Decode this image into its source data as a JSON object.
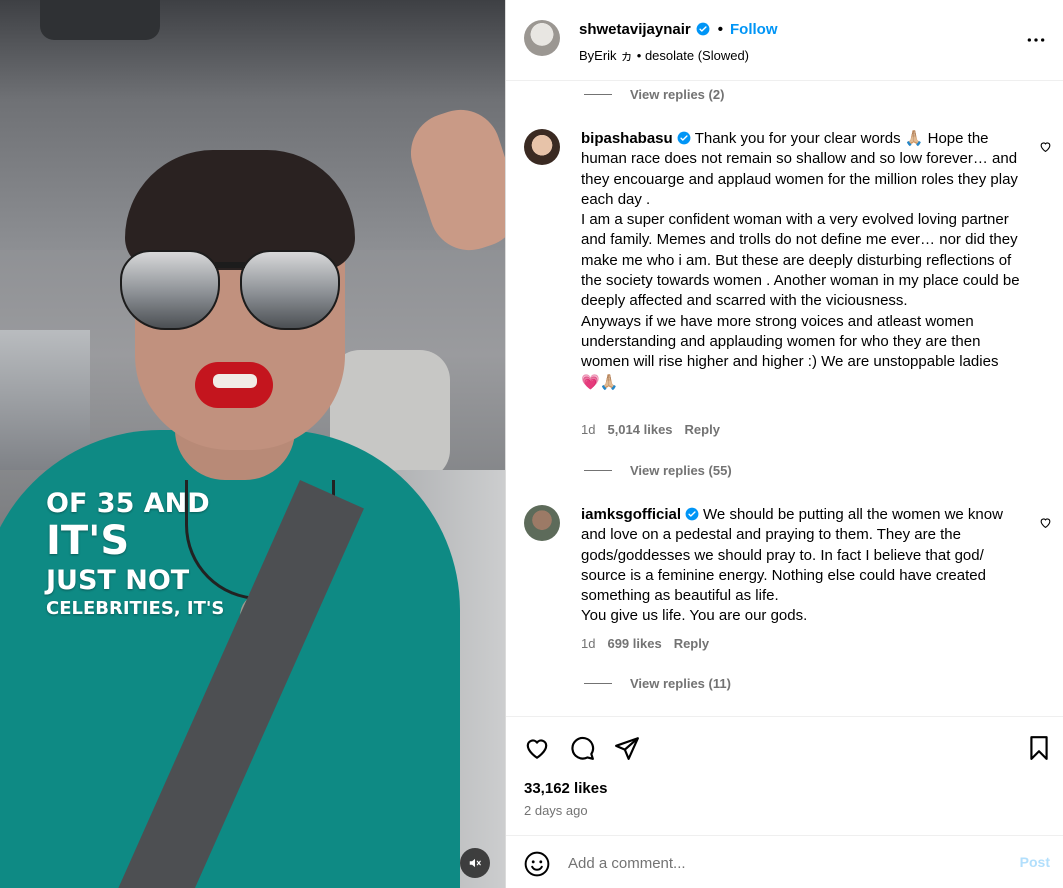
{
  "post": {
    "author": "shwetavijaynair",
    "follow_label": "Follow",
    "dot": "•",
    "audio_line": "ByErik ヵ • desolate (Slowed)",
    "video_overlay": [
      "OF 35 AND",
      "IT'S",
      "JUST NOT",
      "CELEBRITIES, IT'S"
    ]
  },
  "comments": [
    {
      "reply_toggle": "View replies (2)"
    },
    {
      "username": "bipashabasu",
      "text": "Thank you for your clear words 🙏🏼 Hope the human race does not remain so shallow and so low forever… and they encouarge and applaud women for the million roles they play each day .\nI am a super confident woman with a very evolved loving partner and family. Memes and trolls do not define me ever… nor did they make me who i am. But these are deeply disturbing reflections of the society towards women . Another woman in my place could be deeply affected and scarred with the viciousness.\nAnyways if we have more strong voices and atleast women understanding and applauding women for who they are then women will rise higher and higher :) We are unstoppable ladies\n💗🙏🏼",
      "age": "1d",
      "likes": "5,014 likes",
      "reply_label": "Reply",
      "reply_toggle": "View replies (55)"
    },
    {
      "username": "iamksgofficial",
      "text": "We should be putting all the women we know and love on a pedestal and praying to them. They are the gods/goddesses we should pray to. In fact I believe that god/ source is a feminine energy. Nothing else could have created something as beautiful as life.\nYou give us life. You are our gods.",
      "age": "1d",
      "likes": "699 likes",
      "reply_label": "Reply",
      "reply_toggle": "View replies (11)"
    }
  ],
  "footer": {
    "likes": "33,162 likes",
    "time_ago": "2 days ago",
    "comment_placeholder": "Add a comment...",
    "post_label": "Post"
  },
  "colors": {
    "accent": "#0095f6",
    "verified": "#0095f6",
    "muted_text": "#737373",
    "post_disabled": "#b2dffc"
  }
}
